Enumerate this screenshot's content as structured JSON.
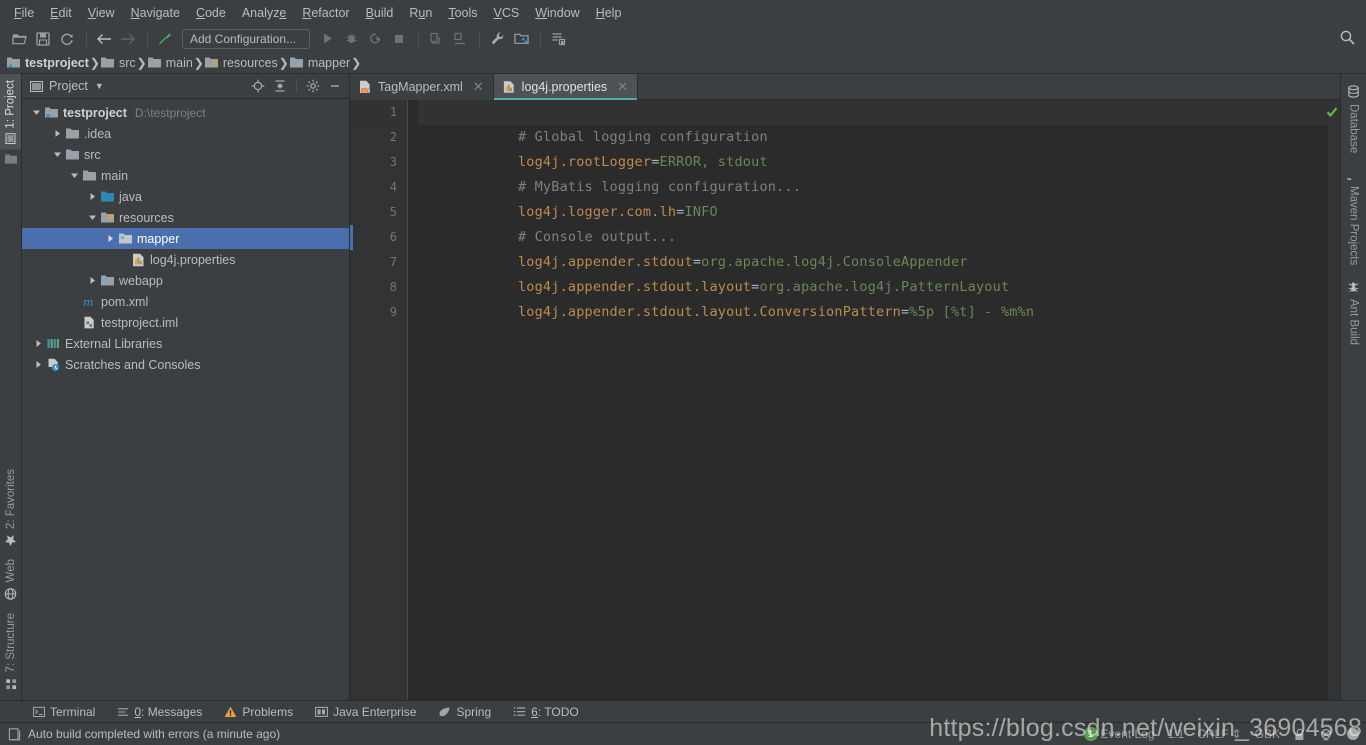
{
  "menubar": {
    "items": [
      {
        "label": "File",
        "mnemonic": "F"
      },
      {
        "label": "Edit",
        "mnemonic": "E"
      },
      {
        "label": "View",
        "mnemonic": "V"
      },
      {
        "label": "Navigate",
        "mnemonic": "N"
      },
      {
        "label": "Code",
        "mnemonic": "C"
      },
      {
        "label": "Analyze",
        "mnemonic": "A"
      },
      {
        "label": "Refactor",
        "mnemonic": "R"
      },
      {
        "label": "Build",
        "mnemonic": "B"
      },
      {
        "label": "Run",
        "mnemonic": "R"
      },
      {
        "label": "Tools",
        "mnemonic": "T"
      },
      {
        "label": "VCS",
        "mnemonic": "V"
      },
      {
        "label": "Window",
        "mnemonic": "W"
      },
      {
        "label": "Help",
        "mnemonic": "H"
      }
    ]
  },
  "toolbar": {
    "run_configuration": "Add Configuration...",
    "icons": [
      "open-folder-icon",
      "save-all-icon",
      "sync-refresh-icon",
      "back-arrow-icon",
      "forward-arrow-icon",
      "build-hammer-icon"
    ],
    "run_icons": [
      "run-icon",
      "debug-icon",
      "run-coverage-icon",
      "stop-icon",
      "update-app-icon",
      "rerun-app-icon",
      "settings-wrench-icon",
      "project-structure-icon",
      "sync-maven-icon"
    ],
    "search_icon": "search-icon"
  },
  "breadcrumbs": {
    "items": [
      {
        "label": "testproject",
        "icon": "module-icon",
        "error": false
      },
      {
        "label": "src",
        "icon": "folder-icon",
        "error": true
      },
      {
        "label": "main",
        "icon": "folder-icon",
        "error": true
      },
      {
        "label": "resources",
        "icon": "resources-folder-icon",
        "error": false
      },
      {
        "label": "mapper",
        "icon": "folder-icon",
        "error": false
      }
    ]
  },
  "left_rail": {
    "top": [
      {
        "label": "1: Project",
        "mnemonic": "1",
        "active": true,
        "icon": "project-icon"
      }
    ],
    "bottom": [
      {
        "label": "2: Favorites",
        "mnemonic": "2",
        "icon": "star-icon"
      },
      {
        "label": "Web",
        "mnemonic": "",
        "icon": "web-globe-icon"
      },
      {
        "label": "7: Structure",
        "mnemonic": "7",
        "icon": "structure-icon"
      }
    ]
  },
  "right_rail": {
    "items": [
      {
        "label": "Database",
        "icon": "database-icon"
      },
      {
        "label": "Maven Projects",
        "icon": "maven-m-icon"
      },
      {
        "label": "Ant Build",
        "icon": "ant-icon"
      }
    ]
  },
  "project_panel": {
    "title": "Project",
    "dropdown_icon": "chevron-down-icon",
    "tools": [
      "locate-target-icon",
      "collapse-all-icon",
      "gear-icon",
      "hide-minimize-icon"
    ],
    "tree": [
      {
        "label": "testproject",
        "sublabel": "D:\\testproject",
        "indent": 0,
        "arrow": "down",
        "icon": "module-icon",
        "bold": true,
        "selected": false
      },
      {
        "label": ".idea",
        "sublabel": "",
        "indent": 1,
        "arrow": "right",
        "icon": "folder-icon",
        "bold": false,
        "selected": false
      },
      {
        "label": "src",
        "sublabel": "",
        "indent": 1,
        "arrow": "down",
        "icon": "folder-icon",
        "bold": false,
        "selected": false
      },
      {
        "label": "main",
        "sublabel": "",
        "indent": 2,
        "arrow": "down",
        "icon": "folder-icon",
        "bold": false,
        "selected": false
      },
      {
        "label": "java",
        "sublabel": "",
        "indent": 3,
        "arrow": "right",
        "icon": "source-folder-icon",
        "bold": false,
        "selected": false
      },
      {
        "label": "resources",
        "sublabel": "",
        "indent": 3,
        "arrow": "down",
        "icon": "resources-folder-icon",
        "bold": false,
        "selected": false
      },
      {
        "label": "mapper",
        "sublabel": "",
        "indent": 4,
        "arrow": "right",
        "icon": "package-folder-icon",
        "bold": false,
        "selected": true
      },
      {
        "label": "log4j.properties",
        "sublabel": "",
        "indent": 4,
        "arrow": "none",
        "icon": "properties-file-icon",
        "bold": false,
        "selected": false
      },
      {
        "label": "webapp",
        "sublabel": "",
        "indent": 3,
        "arrow": "right",
        "icon": "webapp-folder-icon",
        "bold": false,
        "selected": false
      },
      {
        "label": "pom.xml",
        "sublabel": "",
        "indent": 2,
        "arrow": "none",
        "icon": "maven-m-icon",
        "bold": false,
        "selected": false
      },
      {
        "label": "testproject.iml",
        "sublabel": "",
        "indent": 2,
        "arrow": "none",
        "icon": "iml-file-icon",
        "bold": false,
        "selected": false
      },
      {
        "label": "External Libraries",
        "sublabel": "",
        "indent": 0,
        "arrow": "right",
        "icon": "libraries-icon",
        "bold": false,
        "selected": false
      },
      {
        "label": "Scratches and Consoles",
        "sublabel": "",
        "indent": 0,
        "arrow": "right",
        "icon": "scratches-icon",
        "bold": false,
        "selected": false
      }
    ]
  },
  "editor": {
    "tabs": [
      {
        "label": "TagMapper.xml",
        "icon": "xml-file-icon",
        "active": false,
        "close_icon": "close-icon"
      },
      {
        "label": "log4j.properties",
        "icon": "properties-file-icon",
        "active": true,
        "close_icon": "close-icon"
      }
    ],
    "inspection_status_icon": "green-check-icon",
    "caret_line": 1,
    "marked_line": 6,
    "lines": [
      {
        "number": "1",
        "tokens": [
          {
            "t": "comment",
            "v": "# Global logging configuration"
          }
        ]
      },
      {
        "number": "2",
        "tokens": [
          {
            "t": "key",
            "v": "log4j.rootLogger"
          },
          {
            "t": "eq",
            "v": "="
          },
          {
            "t": "val",
            "v": "ERROR, stdout"
          }
        ]
      },
      {
        "number": "3",
        "tokens": [
          {
            "t": "comment",
            "v": "# MyBatis logging configuration..."
          }
        ]
      },
      {
        "number": "4",
        "tokens": [
          {
            "t": "key",
            "v": "log4j.logger.com.lh"
          },
          {
            "t": "eq",
            "v": "="
          },
          {
            "t": "val",
            "v": "INFO"
          }
        ]
      },
      {
        "number": "5",
        "tokens": [
          {
            "t": "comment",
            "v": "# Console output..."
          }
        ]
      },
      {
        "number": "6",
        "tokens": [
          {
            "t": "key",
            "v": "log4j.appender.stdout"
          },
          {
            "t": "eq",
            "v": "="
          },
          {
            "t": "val",
            "v": "org.apache.log4j.ConsoleAppender"
          }
        ]
      },
      {
        "number": "7",
        "tokens": [
          {
            "t": "key",
            "v": "log4j.appender.stdout.layout"
          },
          {
            "t": "eq",
            "v": "="
          },
          {
            "t": "val",
            "v": "org.apache.log4j.PatternLayout"
          }
        ]
      },
      {
        "number": "8",
        "tokens": [
          {
            "t": "key",
            "v": "log4j.appender.stdout.layout.ConversionPattern"
          },
          {
            "t": "eq",
            "v": "="
          },
          {
            "t": "val",
            "v": "%5p [%t] - %m%n"
          }
        ]
      },
      {
        "number": "9",
        "tokens": []
      }
    ]
  },
  "tool_windows": {
    "items": [
      {
        "label": "Terminal",
        "mnemonic": "",
        "icon": "terminal-icon"
      },
      {
        "label": "0: Messages",
        "mnemonic": "0",
        "icon": "messages-icon"
      },
      {
        "label": "Problems",
        "mnemonic": "",
        "icon": "warning-triangle-icon"
      },
      {
        "label": "Java Enterprise",
        "mnemonic": "",
        "icon": "java-enterprise-icon"
      },
      {
        "label": "Spring",
        "mnemonic": "",
        "icon": "spring-leaf-icon"
      },
      {
        "label": "6: TODO",
        "mnemonic": "6",
        "icon": "todo-list-icon"
      }
    ]
  },
  "statusbar": {
    "icon": "build-status-icon",
    "message": "Auto build completed with errors (a minute ago)",
    "event_log": {
      "label": "Event Log",
      "badge": "1"
    },
    "caret_position": "1:1",
    "line_separator": "CRLF",
    "encoding": "GBK",
    "lock_icon": "unlocked-icon",
    "inspections_icon": "inspections-icon",
    "memory_icon": "memory-indicator-icon"
  },
  "watermark": {
    "text": "https://blog.csdn.net/weixin_36904568"
  },
  "colors": {
    "chrome": "#3C3F41",
    "editor_bg": "#2B2B2B",
    "gutter_bg": "#313335",
    "selection": "#4B6EAF",
    "accent_tab": "#4EAEA8",
    "comment": "#808080",
    "key": "#BC8B4E",
    "value": "#6A8759",
    "error": "#C75450",
    "ok_green": "#5A9E4B"
  }
}
